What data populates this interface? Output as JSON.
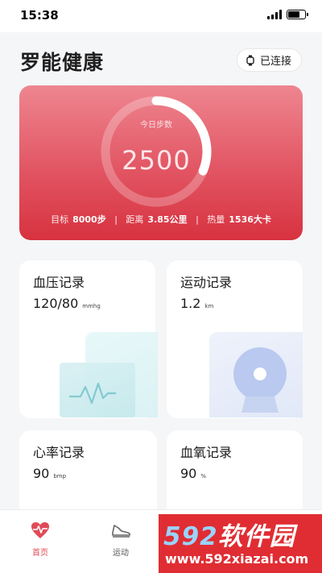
{
  "status_bar": {
    "time": "15:38"
  },
  "header": {
    "title": "罗能健康",
    "connect_label": "已连接"
  },
  "steps": {
    "label": "今日步数",
    "value": "2500",
    "progress": 0.3125,
    "goal_label": "目标",
    "goal_value": "8000步",
    "distance_label": "距离",
    "distance_value": "3.85公里",
    "calorie_label": "热量",
    "calorie_value": "1536大卡"
  },
  "tiles": {
    "blood_pressure": {
      "title": "血压记录",
      "value": "120/80",
      "unit": "mmhg"
    },
    "exercise": {
      "title": "运动记录",
      "value": "1.2",
      "unit": "km"
    },
    "heart_rate": {
      "title": "心率记录",
      "value": "90",
      "unit": "bmp"
    },
    "blood_oxygen": {
      "title": "血氧记录",
      "value": "90",
      "unit": "%"
    }
  },
  "nav": {
    "home": "首页",
    "sport": "运动"
  },
  "watermark": {
    "brand": "软件园",
    "number": "592",
    "url": "www.592xiazai.com"
  },
  "colors": {
    "accent": "#e04a57",
    "card_top": "#ee8690",
    "card_bottom": "#d7323f"
  }
}
